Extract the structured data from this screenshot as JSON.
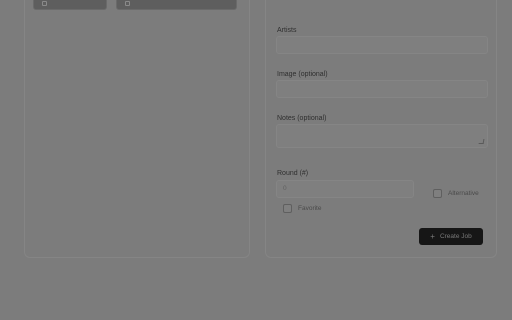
{
  "toolbar": {
    "button_a_label": "",
    "button_b_label": ""
  },
  "form": {
    "helper_text": "",
    "title_label": "Artists",
    "title_placeholder": "",
    "link_label": "Image (optional)",
    "link_placeholder": "",
    "notes_label": "Notes (optional)",
    "notes_placeholder": "",
    "count_label": "Round (#)",
    "count_value": "0",
    "favorite_label": "Favorite",
    "other_label": "Alternative",
    "submit_label": "Create Job"
  }
}
